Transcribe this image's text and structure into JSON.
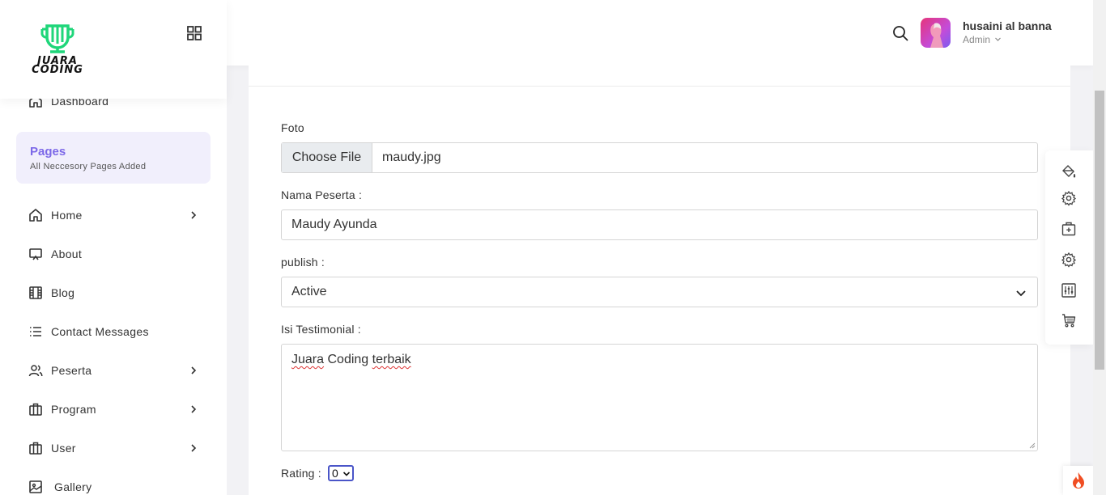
{
  "brand": {
    "logo_text_line1": "JUARA",
    "logo_text_line2": "CODING",
    "accent_color": "#1fd67a"
  },
  "sidebar": {
    "dashboard_label": "Dashboard",
    "pages_title": "Pages",
    "pages_subtitle": "All Neccesory Pages Added",
    "items": [
      {
        "label": "Home",
        "icon": "home-icon",
        "has_submenu": true
      },
      {
        "label": "About",
        "icon": "monitor-icon",
        "has_submenu": false
      },
      {
        "label": "Blog",
        "icon": "film-icon",
        "has_submenu": false
      },
      {
        "label": "Contact Messages",
        "icon": "list-icon",
        "has_submenu": false
      },
      {
        "label": "Peserta",
        "icon": "users-icon",
        "has_submenu": true
      },
      {
        "label": "Program",
        "icon": "briefcase-icon",
        "has_submenu": true
      },
      {
        "label": "User",
        "icon": "briefcase-icon",
        "has_submenu": true
      },
      {
        "label": "Gallery",
        "icon": "image-icon",
        "has_submenu": false
      }
    ]
  },
  "topbar": {
    "user_name": "husaini al banna",
    "user_role": "Admin"
  },
  "form": {
    "foto_label": "Foto",
    "choose_file_label": "Choose File",
    "file_name": "maudy.jpg",
    "nama_label": "Nama Peserta :",
    "nama_value": "Maudy Ayunda",
    "publish_label": "publish :",
    "publish_value": "Active",
    "isi_label": "Isi Testimonial :",
    "isi_word1": "Juara",
    "isi_word2": "Coding",
    "isi_word3": "terbaik",
    "rating_label": "Rating :",
    "rating_value": "0"
  },
  "tools": [
    "paint-bucket-icon",
    "gear-icon",
    "add-box-icon",
    "gear-icon",
    "sliders-icon",
    "cart-icon"
  ],
  "colors": {
    "primary": "#7c68e8",
    "pages_bg": "#f1effc"
  }
}
